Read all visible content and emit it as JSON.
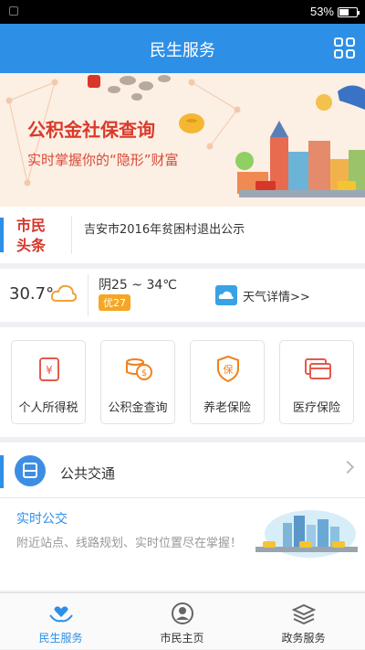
{
  "status": {
    "battery": "53%"
  },
  "header": {
    "title": "民生服务"
  },
  "banner": {
    "headline": "公积金社保查询",
    "subline": "实时掌握你的“隐形”财富"
  },
  "news": {
    "tag_line1": "市民",
    "tag_line2": "头条",
    "headline": "吉安市2016年贫困村退出公示"
  },
  "weather": {
    "temperature": "30.7°",
    "forecast": "阴25 ~ 34℃",
    "aqi": "优27",
    "detail": "天气详情>>"
  },
  "services": [
    {
      "label": "个人所得税",
      "icon": "tax-icon"
    },
    {
      "label": "公积金查询",
      "icon": "coins-icon"
    },
    {
      "label": "养老保险",
      "icon": "pension-shield-icon"
    },
    {
      "label": "医疗保险",
      "icon": "medical-card-icon"
    }
  ],
  "transit": {
    "title": "公共交通",
    "realtime_title": "实时公交",
    "realtime_desc": "附近站点、线路规划、实时位置尽在掌握！"
  },
  "tabs": [
    {
      "label": "民生服务",
      "active": true
    },
    {
      "label": "市民主页",
      "active": false
    },
    {
      "label": "政务服务",
      "active": false
    }
  ],
  "colors": {
    "primary": "#2e8fe6",
    "accent_red": "#d8362a",
    "aqi_badge": "#f5a623"
  }
}
